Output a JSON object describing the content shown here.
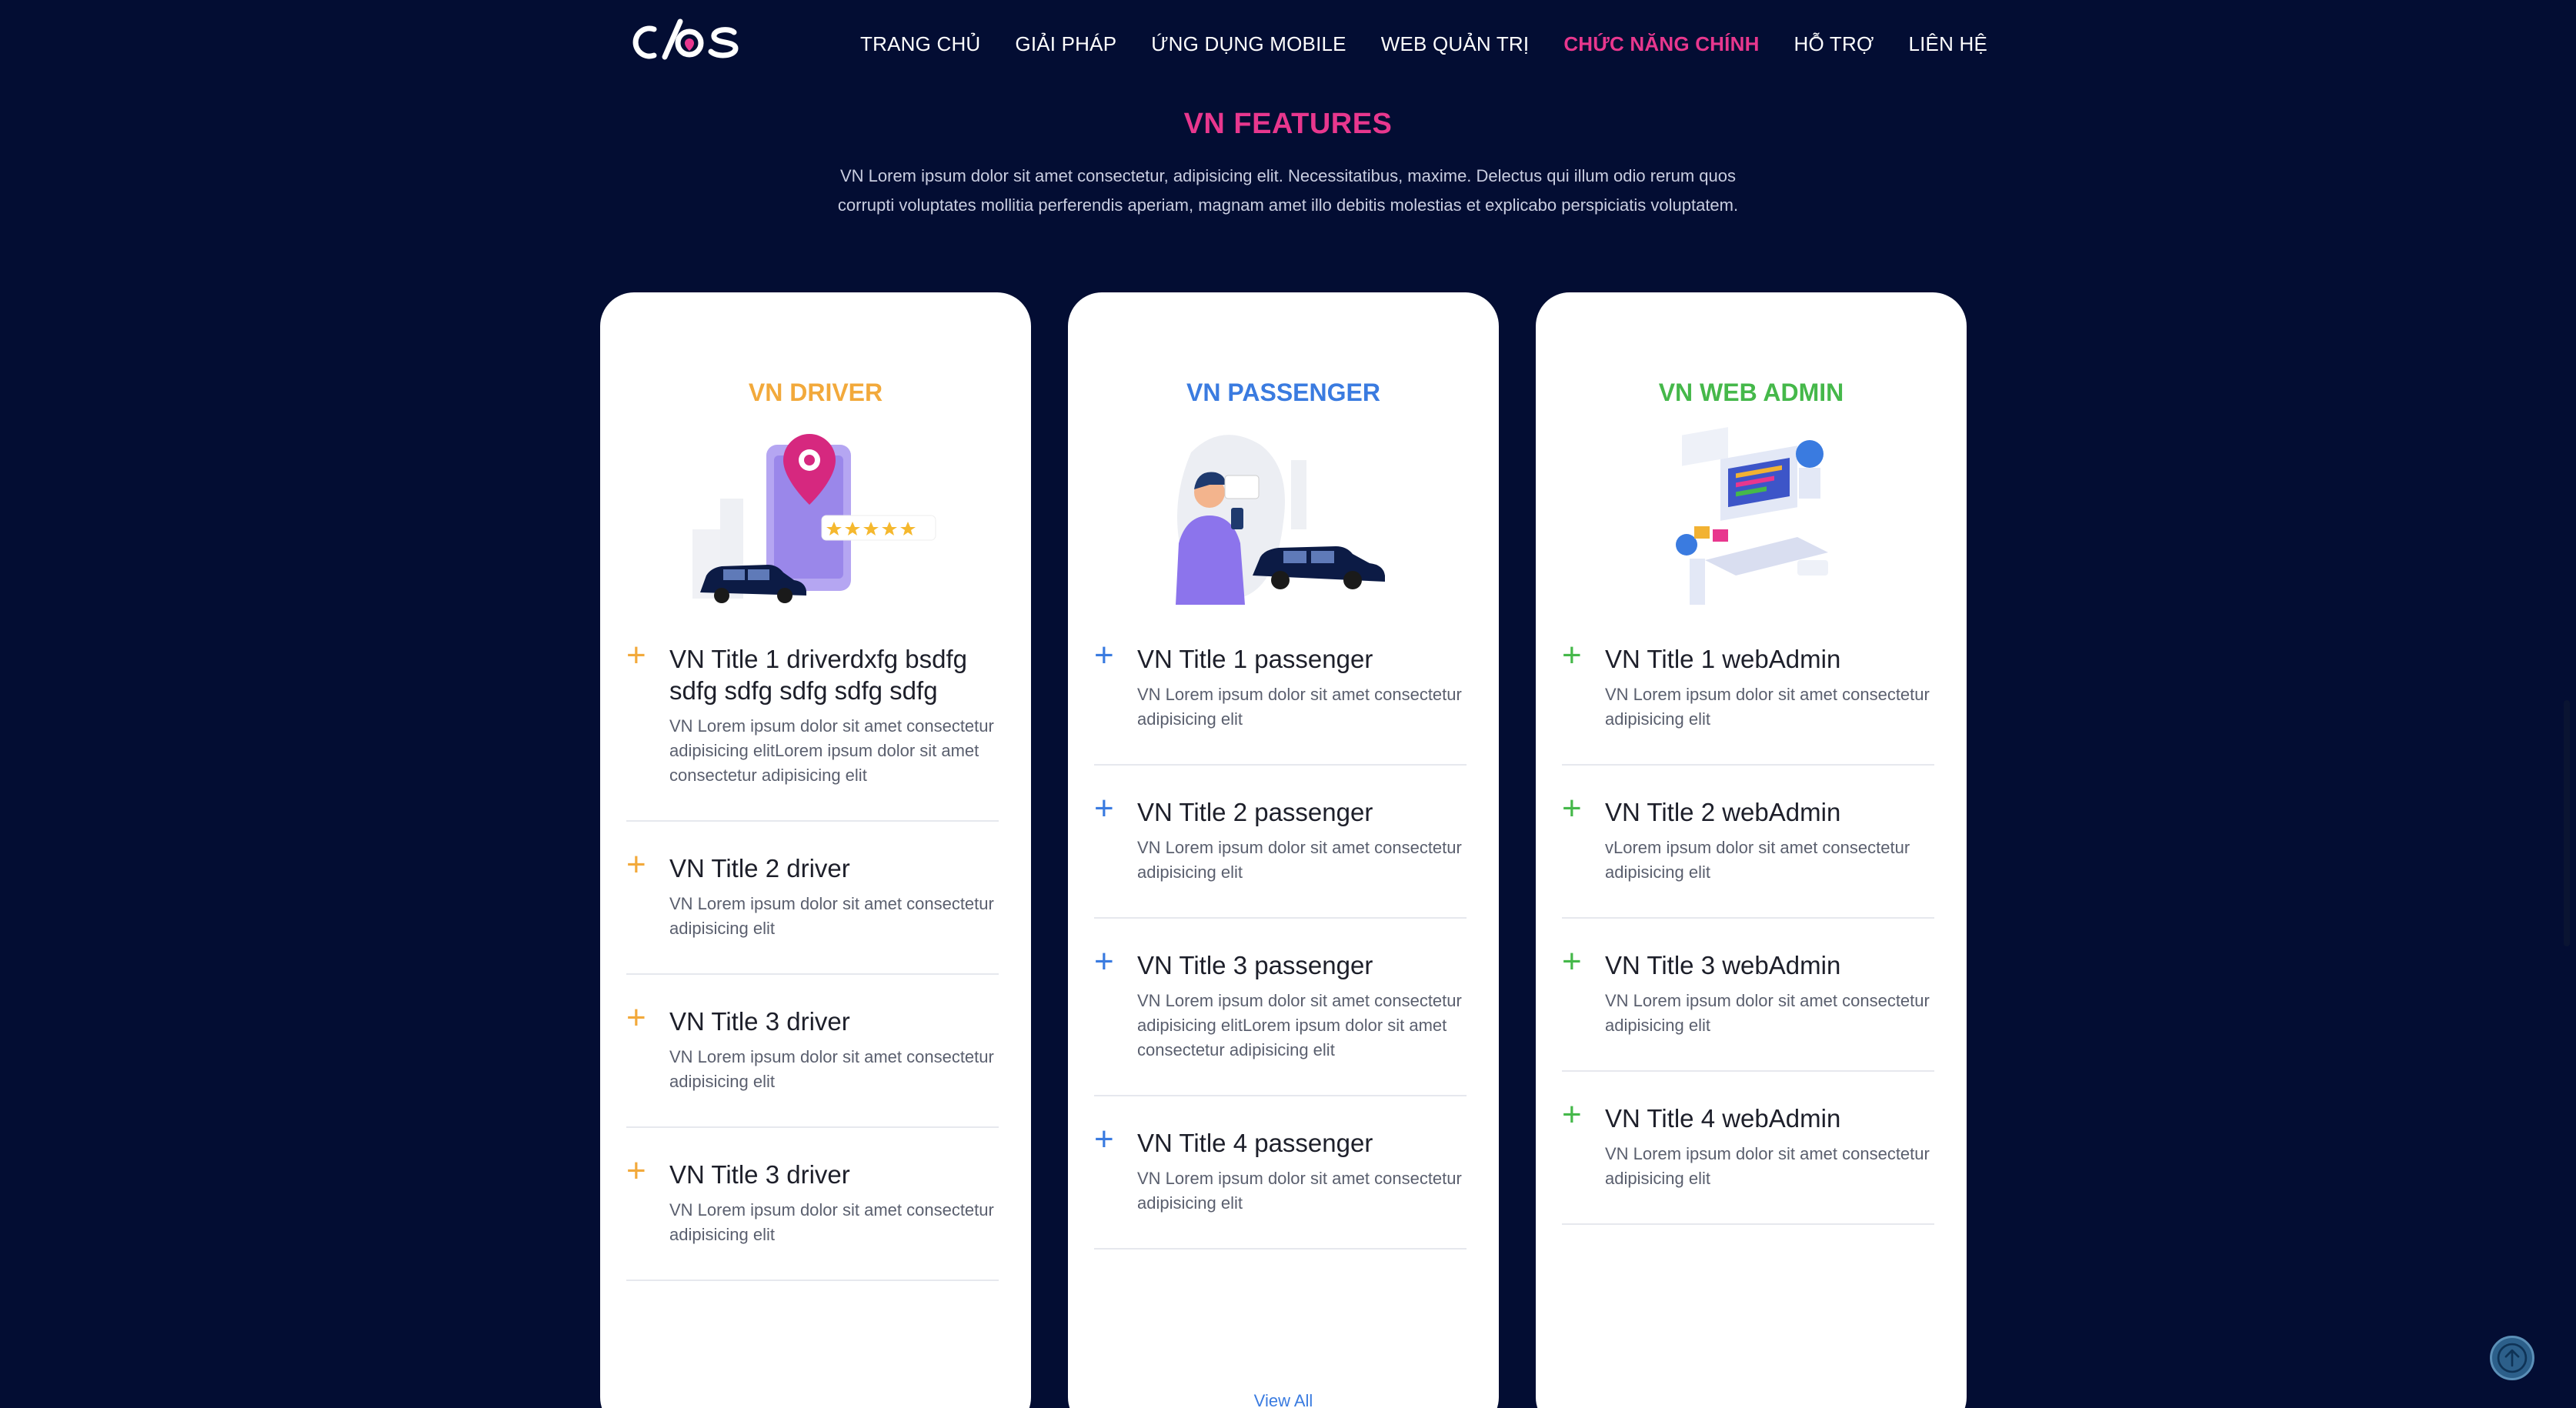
{
  "nav": {
    "logo_alt": "cios",
    "items": [
      "TRANG CHỦ",
      "GIẢI PHÁP",
      "ỨNG DỤNG MOBILE",
      "WEB QUẢN TRỊ",
      "CHỨC NĂNG CHÍNH",
      "HỖ TRỢ",
      "LIÊN HỆ"
    ],
    "active_index": 4
  },
  "section": {
    "title": "VN FEATURES",
    "description": "VN Lorem ipsum dolor sit amet consectetur, adipisicing elit. Necessitatibus, maxime. Delectus qui illum odio rerum quos corrupti voluptates mollitia perferendis aperiam, magnam amet illo debitis molestias et explicabo perspiciatis voluptatem."
  },
  "cards": [
    {
      "title": "VN DRIVER",
      "color": "#f2a93b",
      "icon": "driver-illustration",
      "items": [
        {
          "title": "VN Title 1 driverdxfg bsdfg sdfg sdfg sdfg sdfg sdfg",
          "desc": "VN Lorem ipsum dolor sit amet consectetur adipisicing elitLorem ipsum dolor sit amet consectetur adipisicing elit"
        },
        {
          "title": "VN Title 2 driver",
          "desc": "VN Lorem ipsum dolor sit amet consectetur adipisicing elit"
        },
        {
          "title": "VN Title 3 driver",
          "desc": "VN Lorem ipsum dolor sit amet consectetur adipisicing elit"
        },
        {
          "title": "VN Title 3 driver",
          "desc": "VN Lorem ipsum dolor sit amet consectetur adipisicing elit"
        }
      ]
    },
    {
      "title": "VN PASSENGER",
      "color": "#3a7be0",
      "icon": "passenger-illustration",
      "items": [
        {
          "title": "VN Title 1 passenger",
          "desc": "VN Lorem ipsum dolor sit amet consectetur adipisicing elit"
        },
        {
          "title": "VN Title 2 passenger",
          "desc": "VN Lorem ipsum dolor sit amet consectetur adipisicing elit"
        },
        {
          "title": "VN Title 3 passenger",
          "desc": "VN Lorem ipsum dolor sit amet consectetur adipisicing elitLorem ipsum dolor sit amet consectetur adipisicing elit"
        },
        {
          "title": "VN Title 4 passenger",
          "desc": "VN Lorem ipsum dolor sit amet consectetur adipisicing elit"
        }
      ],
      "view_all": "View All"
    },
    {
      "title": "VN WEB ADMIN",
      "color": "#45b84a",
      "icon": "web-admin-illustration",
      "items": [
        {
          "title": "VN Title 1 webAdmin",
          "desc": "VN Lorem ipsum dolor sit amet consectetur adipisicing elit"
        },
        {
          "title": "VN Title 2 webAdmin",
          "desc": "vLorem ipsum dolor sit amet consectetur adipisicing elit"
        },
        {
          "title": "VN Title 3 webAdmin",
          "desc": "VN Lorem ipsum dolor sit amet consectetur adipisicing elit"
        },
        {
          "title": "VN Title 4 webAdmin",
          "desc": "VN Lorem ipsum dolor sit amet consectetur adipisicing elit"
        }
      ]
    }
  ],
  "plus_glyph": "+",
  "scroll_top_icon": "arrow-up-icon"
}
